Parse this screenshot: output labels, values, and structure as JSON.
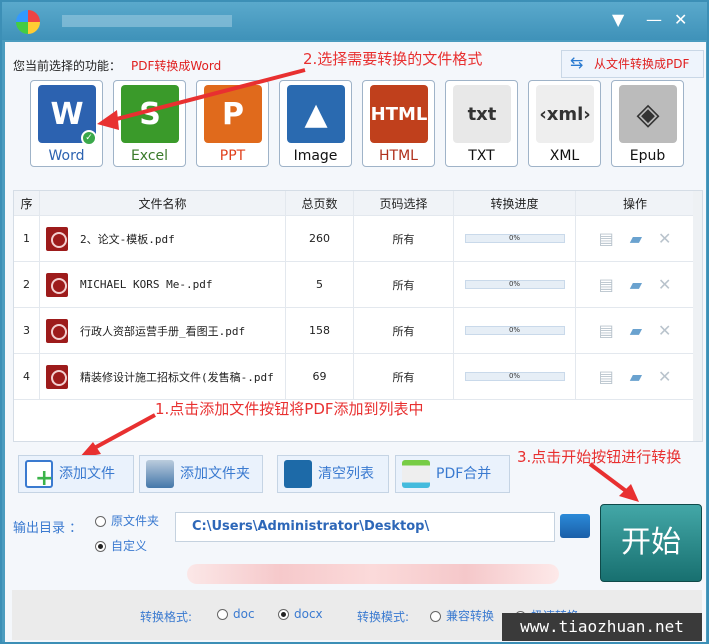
{
  "window": {
    "title": "",
    "controls": [
      "menu",
      "minimize",
      "close"
    ]
  },
  "function_label": "您当前选择的功能：",
  "function_value": "PDF转换成Word",
  "from_file_button": "从文件转换成PDF",
  "tips": {
    "step1": "1.点击添加文件按钮将PDF添加到列表中",
    "step2": "2.选择需要转换的文件格式",
    "step3": "3.点击开始按钮进行转换"
  },
  "formats": [
    {
      "label": "Word",
      "glyph": "W",
      "color": "#2c62b0",
      "text_color": "#2c62b0",
      "selected": true
    },
    {
      "label": "Excel",
      "glyph": "S",
      "color": "#3a9a2a",
      "text_color": "#3a7a2a"
    },
    {
      "label": "PPT",
      "glyph": "P",
      "color": "#e06a1c",
      "text_color": "#e0401c"
    },
    {
      "label": "Image",
      "glyph": "▲",
      "color": "#2a6ab0",
      "text_color": "#111"
    },
    {
      "label": "HTML",
      "glyph": "HTML",
      "color": "#c0401c",
      "text_color": "#b0301c"
    },
    {
      "label": "TXT",
      "glyph": "txt",
      "color": "#e8e8e8",
      "text_color": "#111"
    },
    {
      "label": "XML",
      "glyph": "‹xml›",
      "color": "#eeeeee",
      "text_color": "#111"
    },
    {
      "label": "Epub",
      "glyph": "◈",
      "color": "#bbbbbb",
      "text_color": "#111"
    }
  ],
  "table": {
    "headers": [
      "序",
      "文件名称",
      "总页数",
      "页码选择",
      "转换进度",
      "操作"
    ],
    "rows": [
      {
        "index": "1",
        "name": "2、论文-模板.pdf",
        "pages": "260",
        "range": "所有",
        "progress": "0%"
      },
      {
        "index": "2",
        "name": "MICHAEL KORS Me-.pdf",
        "pages": "5",
        "range": "所有",
        "progress": "0%"
      },
      {
        "index": "3",
        "name": "行政人资部运营手册_看图王.pdf",
        "pages": "158",
        "range": "所有",
        "progress": "0%"
      },
      {
        "index": "4",
        "name": "精装修设计施工招标文件(发售稿-.pdf",
        "pages": "69",
        "range": "所有",
        "progress": "0%"
      }
    ]
  },
  "buttons": {
    "add_file": "添加文件",
    "add_folder": "添加文件夹",
    "clear_list": "清空列表",
    "merge": "PDF合并",
    "start": "开始"
  },
  "output": {
    "label": "输出目录 ：",
    "option_source": "原文件夹",
    "option_custom": "自定义",
    "selected": "custom",
    "path": "C:\\Users\\Administrator\\Desktop\\"
  },
  "options": {
    "format_label": "转换格式:",
    "doc": "doc",
    "docx": "docx",
    "format_selected": "docx",
    "mode_label": "转换模式:",
    "compatible": "兼容转换",
    "fast": "极速转换",
    "mode_selected": "fast"
  },
  "watermark": "www.tiaozhuan.net"
}
